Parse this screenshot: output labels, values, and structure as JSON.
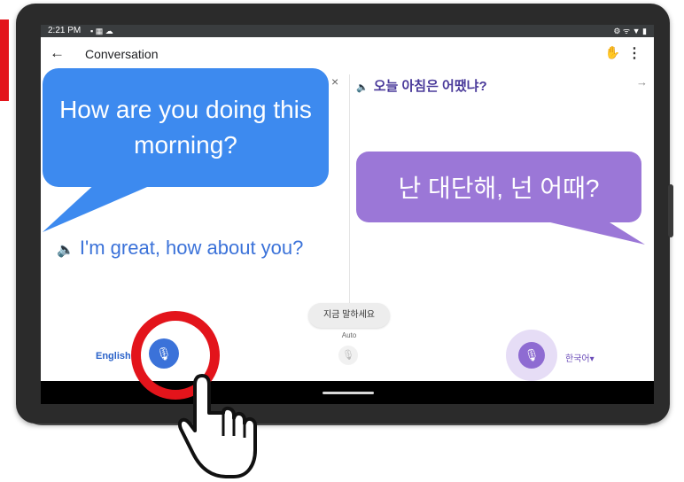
{
  "status_bar": {
    "time": "2:21 PM",
    "left_icons": "▪ ▦ ☁",
    "right_icons": "⚙ ᯤ ▼ ▮"
  },
  "app_bar": {
    "back_glyph": "←",
    "title": "Conversation",
    "hand_glyph": "✋",
    "menu_glyph": "⋮"
  },
  "left_panel": {
    "close_glyph": "×",
    "speaker_glyph": "🔈",
    "translation": "I'm great, how about you?"
  },
  "right_panel": {
    "speaker_glyph": "🔈",
    "source_text": "오늘 아침은 어땠냐?",
    "arrow_glyph": "→"
  },
  "bottom": {
    "prompt": "지금 말하세요",
    "auto_label": "Auto",
    "mic_glyph": "🎙",
    "english_label": "English",
    "korean_label": "한국어▾"
  },
  "bubbles": {
    "english": "How are you doing this morning?",
    "korean": "난 대단해, 넌 어때?"
  },
  "colors": {
    "blue_bubble": "#3d8aef",
    "purple_bubble": "#9b77d7",
    "highlight_ring": "#e3141b"
  }
}
